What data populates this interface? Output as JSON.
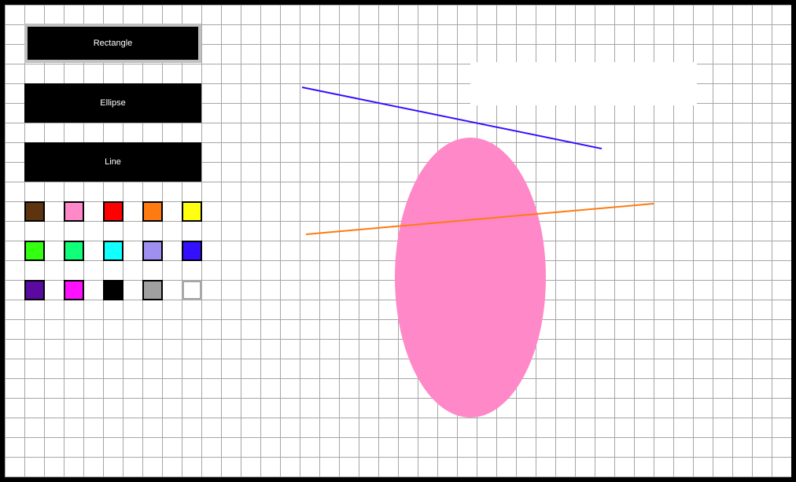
{
  "tools": [
    {
      "label": "Rectangle",
      "selected": true
    },
    {
      "label": "Ellipse",
      "selected": false
    },
    {
      "label": "Line",
      "selected": false
    }
  ],
  "palette": [
    "#5c3510",
    "#ff88c8",
    "#ff0000",
    "#ff7a10",
    "#ffff10",
    "#33ff10",
    "#10ff78",
    "#10ffff",
    "#9f90f0",
    "#3310ff",
    "#5a0aa0",
    "#ff10ff",
    "#000000",
    "#a0a0a0",
    "#ffffff"
  ],
  "selected_color": "#ffffff",
  "shapes": {
    "rectangle": {
      "fill": "#ffffff"
    },
    "ellipse": {
      "fill": "#ff88c8"
    },
    "line1": {
      "stroke": "#3310ff"
    },
    "line2": {
      "stroke": "#ff7a10"
    }
  }
}
